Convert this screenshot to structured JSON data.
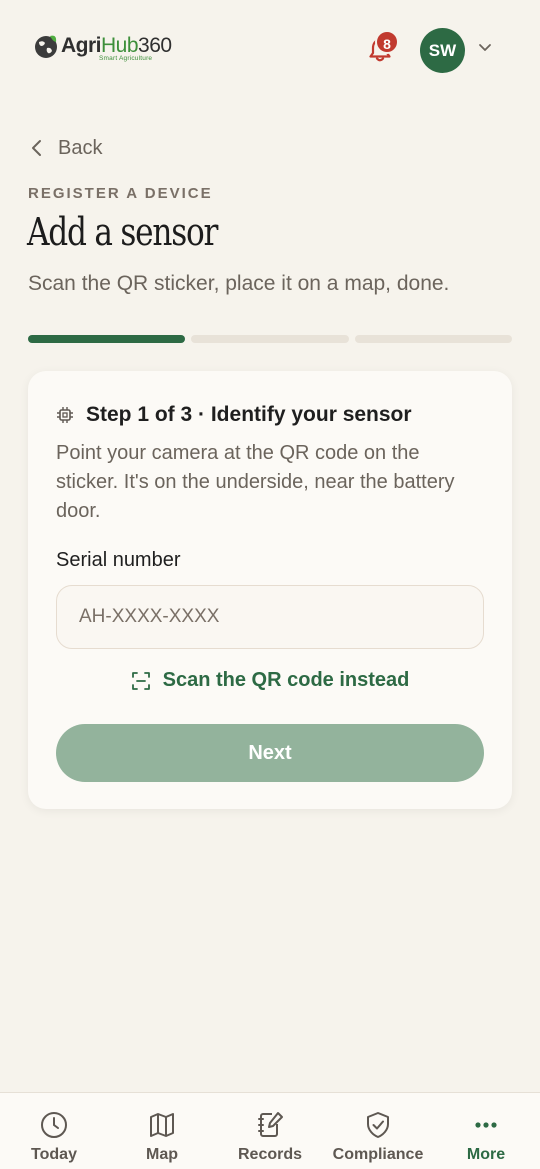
{
  "header": {
    "logo_text_agri": "Agri",
    "logo_text_hub": "Hub",
    "logo_text_num": "360",
    "logo_tagline": "Smart Agriculture",
    "notification_icon": "bell-icon",
    "notification_count": "8",
    "avatar_initials": "SW",
    "avatar_menu_icon": "chevron-down-icon",
    "colors": {
      "avatar_bg": "#2d6a44",
      "badge_bg": "#c13a2f",
      "brand_green": "#3d8f3a"
    }
  },
  "nav": {
    "back_label": "Back",
    "back_icon": "chevron-left-icon"
  },
  "page": {
    "eyebrow": "REGISTER A DEVICE",
    "title": "Add a sensor",
    "subtitle": "Scan the QR sticker, place it on a map, done."
  },
  "progress": {
    "current_step": 1,
    "total_steps": 3
  },
  "card": {
    "step_icon": "chip-icon",
    "step_title": "Step 1 of 3 · Identify your sensor",
    "step_description": "Point your camera at the QR code on the sticker. It's on the underside, near the battery door.",
    "serial_label": "Serial number",
    "serial_value": "",
    "serial_placeholder": "AH-XXXX-XXXX",
    "scan_icon": "qr-scan-icon",
    "scan_label": "Scan the QR code instead",
    "next_label": "Next",
    "colors": {
      "accent": "#2d6a44",
      "button_disabled": "#93b39c"
    }
  },
  "bottom_nav": {
    "items": [
      {
        "label": "Today",
        "icon": "clock-icon"
      },
      {
        "label": "Map",
        "icon": "map-icon"
      },
      {
        "label": "Records",
        "icon": "notebook-edit-icon"
      },
      {
        "label": "Compliance",
        "icon": "shield-check-icon"
      },
      {
        "label": "More",
        "icon": "more-dots-icon",
        "active": true
      }
    ]
  }
}
